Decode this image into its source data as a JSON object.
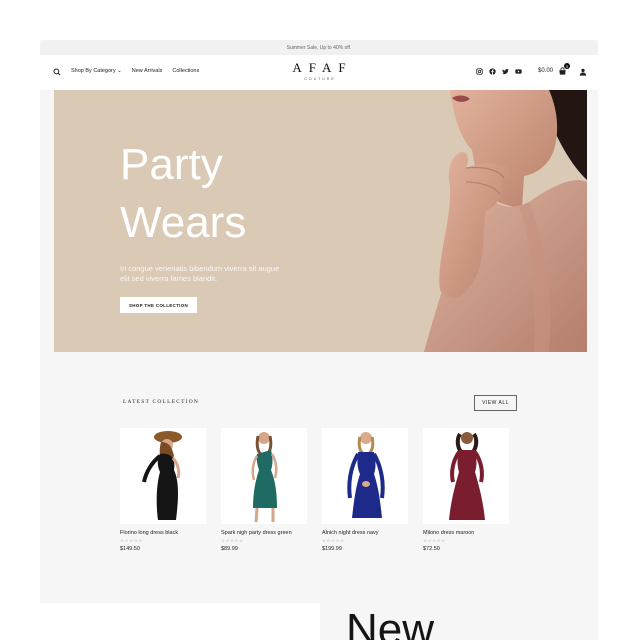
{
  "announcement": "Summer Sale, Up to 40% off.",
  "nav": {
    "items": [
      "Shop By Category",
      "New Arrivals",
      "Collections"
    ],
    "dropdown_caret": "⌄"
  },
  "logo": {
    "main": "AFAF",
    "sub": "COUTURE"
  },
  "header": {
    "cart_total": "$0.00",
    "cart_count": "0"
  },
  "socials": [
    "instagram-icon",
    "facebook-icon",
    "twitter-icon",
    "youtube-icon"
  ],
  "hero": {
    "title_line1": "Party",
    "title_line2": "Wears",
    "text": "In congue venenatis bibendum viverra sit augue elit sed viverra fames blandit.",
    "button": "SHOP THE COLLECTION",
    "colors": {
      "background": "#dac9b4",
      "title": "#ffffff"
    }
  },
  "latest": {
    "title": "LATEST COLLECTION",
    "view_all": "VIEW ALL",
    "products": [
      {
        "name": "Florino long dress black",
        "stars": "☆☆☆☆☆",
        "price": "$149.50",
        "color": "#141414"
      },
      {
        "name": "Spark nigh party dress green",
        "stars": "☆☆☆☆☆",
        "price": "$89.99",
        "color": "#1f6a63"
      },
      {
        "name": "Alnich night dress navy",
        "stars": "☆☆☆☆☆",
        "price": "$199.99",
        "color": "#1d2a8a"
      },
      {
        "name": "Milono dress maroon",
        "stars": "☆☆☆☆☆",
        "price": "$72.50",
        "color": "#7a1d2e"
      }
    ]
  },
  "next_section": {
    "title_partial": "New"
  }
}
